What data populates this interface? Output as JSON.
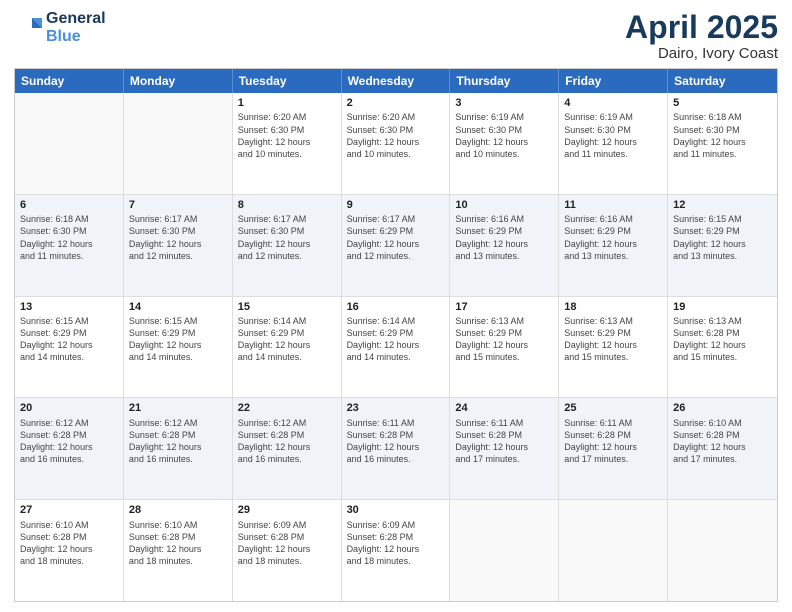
{
  "header": {
    "logo_line1": "General",
    "logo_line2": "Blue",
    "title": "April 2025",
    "location": "Dairo, Ivory Coast"
  },
  "calendar": {
    "weekdays": [
      "Sunday",
      "Monday",
      "Tuesday",
      "Wednesday",
      "Thursday",
      "Friday",
      "Saturday"
    ],
    "rows": [
      {
        "cells": [
          {
            "day": "",
            "info": ""
          },
          {
            "day": "",
            "info": ""
          },
          {
            "day": "1",
            "info": "Sunrise: 6:20 AM\nSunset: 6:30 PM\nDaylight: 12 hours\nand 10 minutes."
          },
          {
            "day": "2",
            "info": "Sunrise: 6:20 AM\nSunset: 6:30 PM\nDaylight: 12 hours\nand 10 minutes."
          },
          {
            "day": "3",
            "info": "Sunrise: 6:19 AM\nSunset: 6:30 PM\nDaylight: 12 hours\nand 10 minutes."
          },
          {
            "day": "4",
            "info": "Sunrise: 6:19 AM\nSunset: 6:30 PM\nDaylight: 12 hours\nand 11 minutes."
          },
          {
            "day": "5",
            "info": "Sunrise: 6:18 AM\nSunset: 6:30 PM\nDaylight: 12 hours\nand 11 minutes."
          }
        ]
      },
      {
        "cells": [
          {
            "day": "6",
            "info": "Sunrise: 6:18 AM\nSunset: 6:30 PM\nDaylight: 12 hours\nand 11 minutes."
          },
          {
            "day": "7",
            "info": "Sunrise: 6:17 AM\nSunset: 6:30 PM\nDaylight: 12 hours\nand 12 minutes."
          },
          {
            "day": "8",
            "info": "Sunrise: 6:17 AM\nSunset: 6:30 PM\nDaylight: 12 hours\nand 12 minutes."
          },
          {
            "day": "9",
            "info": "Sunrise: 6:17 AM\nSunset: 6:29 PM\nDaylight: 12 hours\nand 12 minutes."
          },
          {
            "day": "10",
            "info": "Sunrise: 6:16 AM\nSunset: 6:29 PM\nDaylight: 12 hours\nand 13 minutes."
          },
          {
            "day": "11",
            "info": "Sunrise: 6:16 AM\nSunset: 6:29 PM\nDaylight: 12 hours\nand 13 minutes."
          },
          {
            "day": "12",
            "info": "Sunrise: 6:15 AM\nSunset: 6:29 PM\nDaylight: 12 hours\nand 13 minutes."
          }
        ]
      },
      {
        "cells": [
          {
            "day": "13",
            "info": "Sunrise: 6:15 AM\nSunset: 6:29 PM\nDaylight: 12 hours\nand 14 minutes."
          },
          {
            "day": "14",
            "info": "Sunrise: 6:15 AM\nSunset: 6:29 PM\nDaylight: 12 hours\nand 14 minutes."
          },
          {
            "day": "15",
            "info": "Sunrise: 6:14 AM\nSunset: 6:29 PM\nDaylight: 12 hours\nand 14 minutes."
          },
          {
            "day": "16",
            "info": "Sunrise: 6:14 AM\nSunset: 6:29 PM\nDaylight: 12 hours\nand 14 minutes."
          },
          {
            "day": "17",
            "info": "Sunrise: 6:13 AM\nSunset: 6:29 PM\nDaylight: 12 hours\nand 15 minutes."
          },
          {
            "day": "18",
            "info": "Sunrise: 6:13 AM\nSunset: 6:29 PM\nDaylight: 12 hours\nand 15 minutes."
          },
          {
            "day": "19",
            "info": "Sunrise: 6:13 AM\nSunset: 6:28 PM\nDaylight: 12 hours\nand 15 minutes."
          }
        ]
      },
      {
        "cells": [
          {
            "day": "20",
            "info": "Sunrise: 6:12 AM\nSunset: 6:28 PM\nDaylight: 12 hours\nand 16 minutes."
          },
          {
            "day": "21",
            "info": "Sunrise: 6:12 AM\nSunset: 6:28 PM\nDaylight: 12 hours\nand 16 minutes."
          },
          {
            "day": "22",
            "info": "Sunrise: 6:12 AM\nSunset: 6:28 PM\nDaylight: 12 hours\nand 16 minutes."
          },
          {
            "day": "23",
            "info": "Sunrise: 6:11 AM\nSunset: 6:28 PM\nDaylight: 12 hours\nand 16 minutes."
          },
          {
            "day": "24",
            "info": "Sunrise: 6:11 AM\nSunset: 6:28 PM\nDaylight: 12 hours\nand 17 minutes."
          },
          {
            "day": "25",
            "info": "Sunrise: 6:11 AM\nSunset: 6:28 PM\nDaylight: 12 hours\nand 17 minutes."
          },
          {
            "day": "26",
            "info": "Sunrise: 6:10 AM\nSunset: 6:28 PM\nDaylight: 12 hours\nand 17 minutes."
          }
        ]
      },
      {
        "cells": [
          {
            "day": "27",
            "info": "Sunrise: 6:10 AM\nSunset: 6:28 PM\nDaylight: 12 hours\nand 18 minutes."
          },
          {
            "day": "28",
            "info": "Sunrise: 6:10 AM\nSunset: 6:28 PM\nDaylight: 12 hours\nand 18 minutes."
          },
          {
            "day": "29",
            "info": "Sunrise: 6:09 AM\nSunset: 6:28 PM\nDaylight: 12 hours\nand 18 minutes."
          },
          {
            "day": "30",
            "info": "Sunrise: 6:09 AM\nSunset: 6:28 PM\nDaylight: 12 hours\nand 18 minutes."
          },
          {
            "day": "",
            "info": ""
          },
          {
            "day": "",
            "info": ""
          },
          {
            "day": "",
            "info": ""
          }
        ]
      }
    ]
  }
}
